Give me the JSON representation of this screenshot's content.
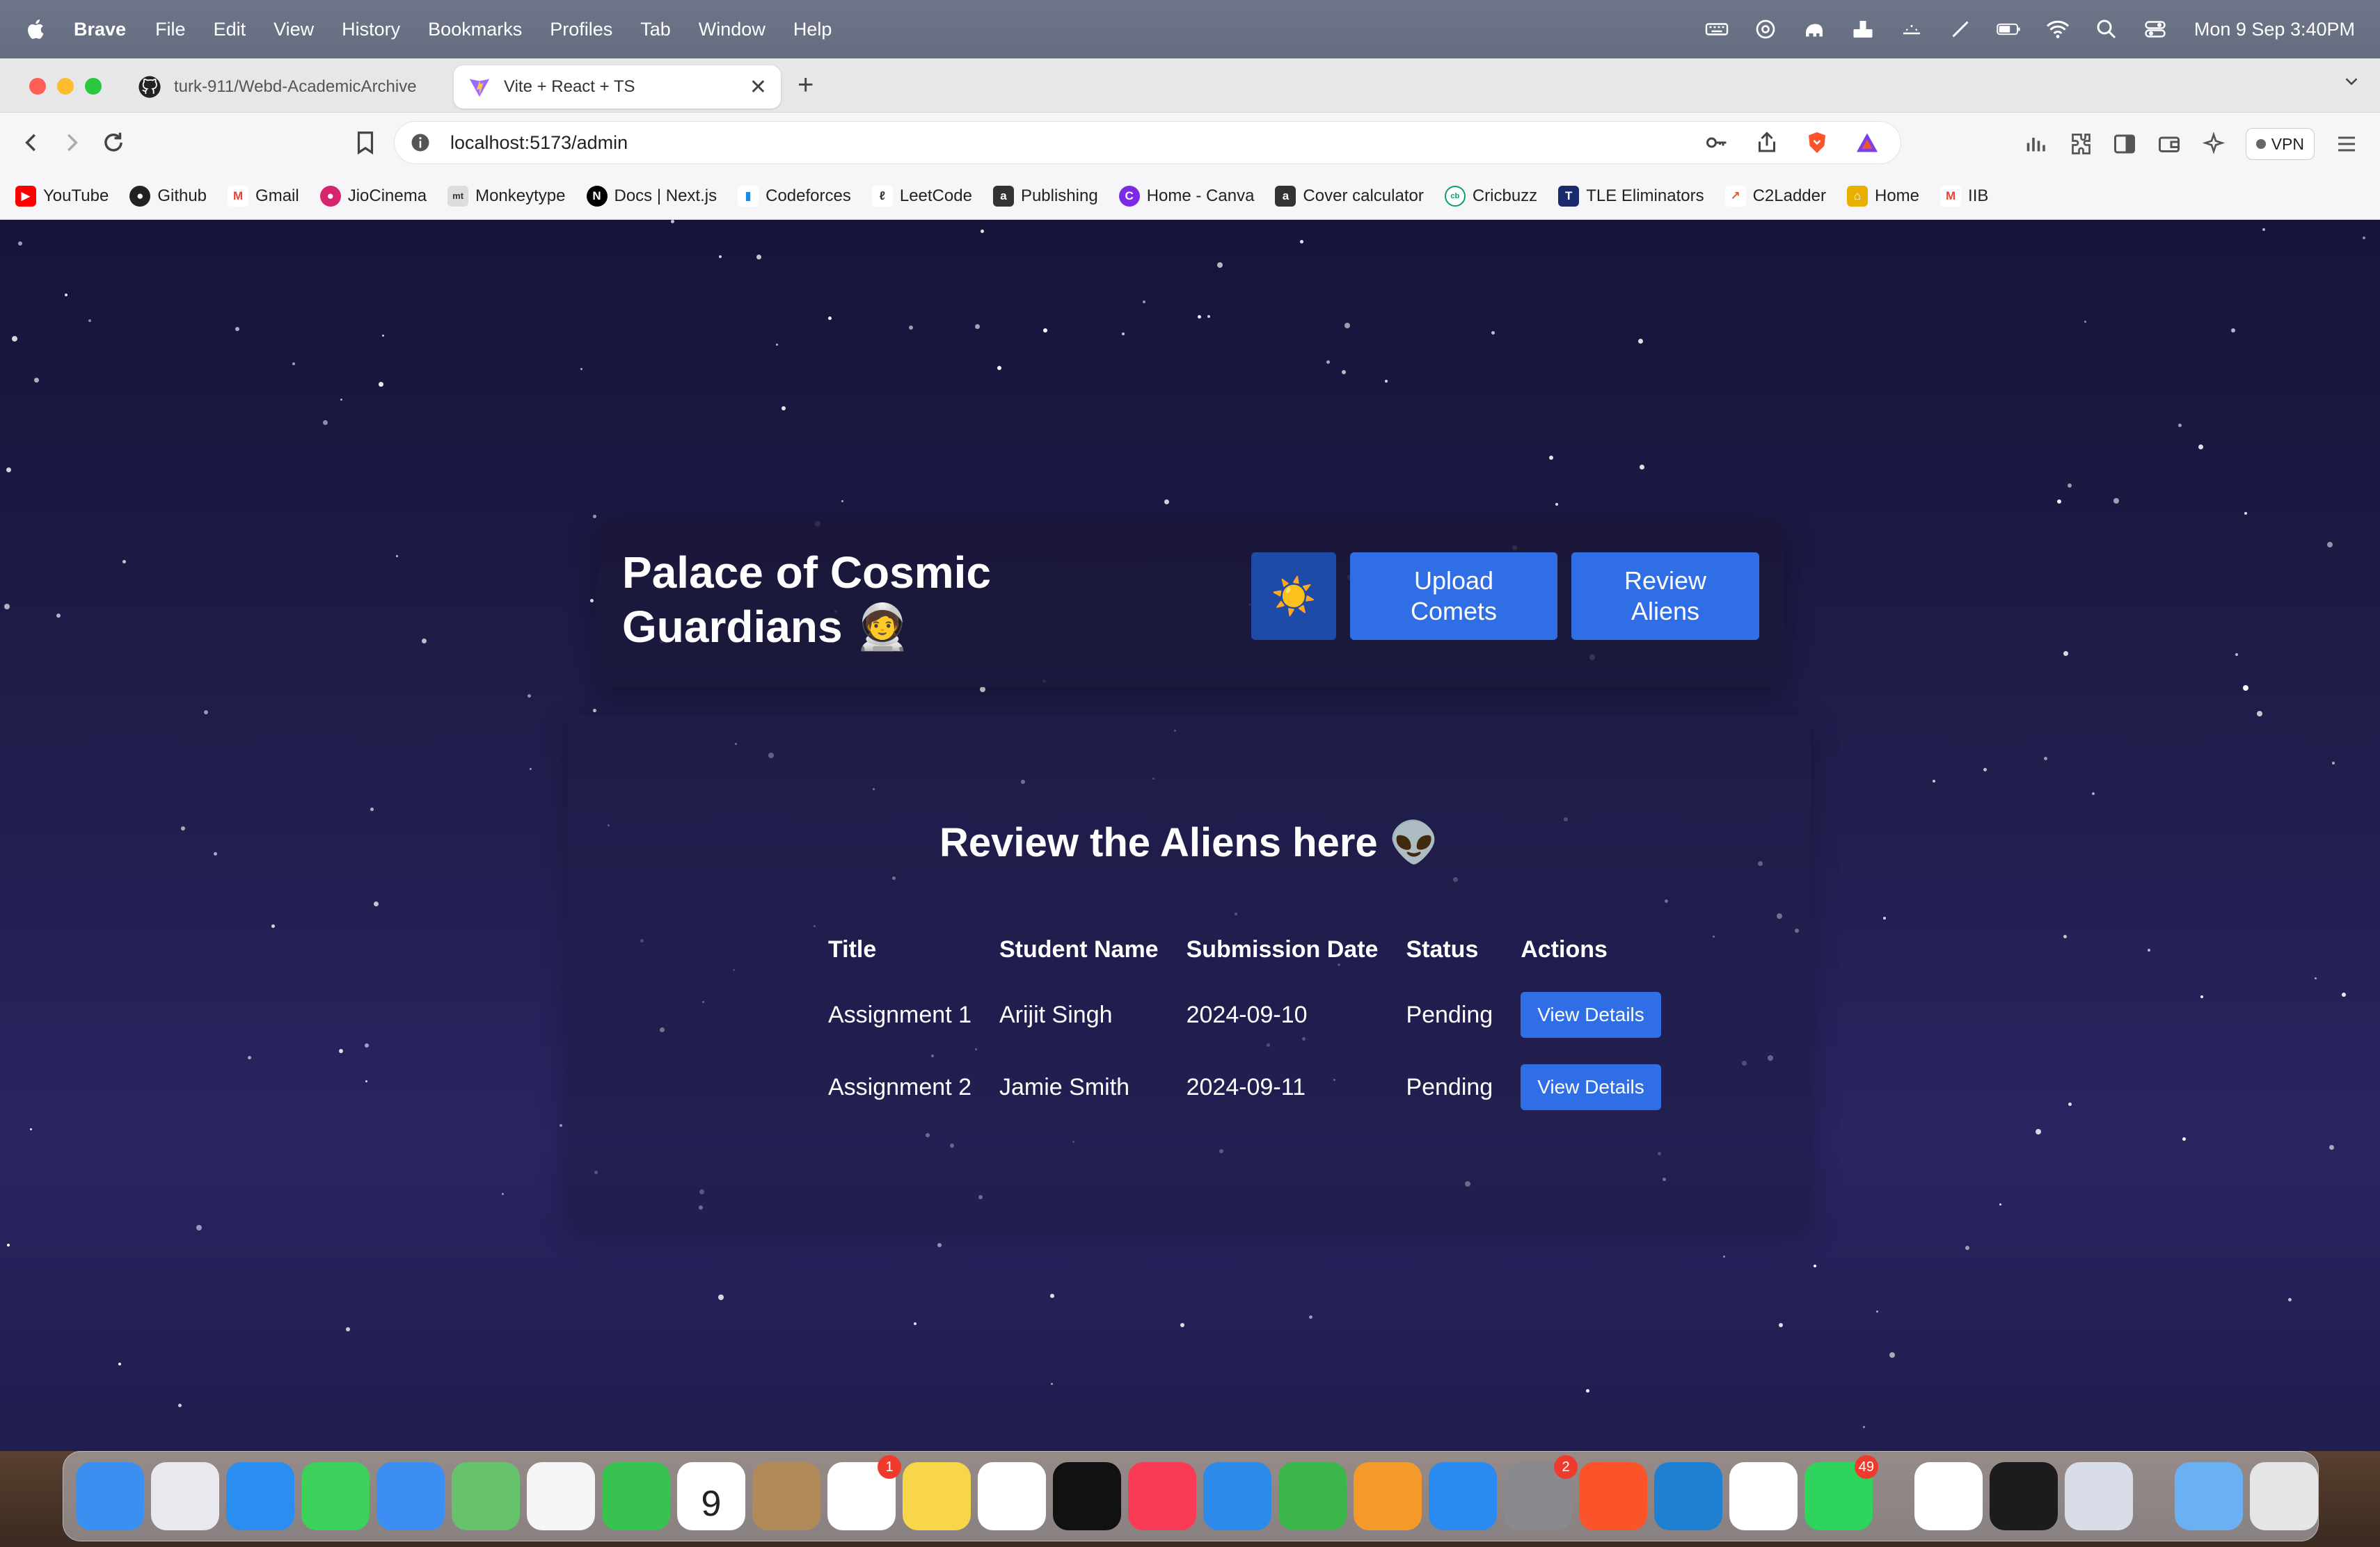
{
  "menubar": {
    "app_name": "Brave",
    "items": [
      "File",
      "Edit",
      "View",
      "History",
      "Bookmarks",
      "Profiles",
      "Tab",
      "Window",
      "Help"
    ],
    "clock": "Mon 9 Sep  3:40PM"
  },
  "browser": {
    "tabs": [
      {
        "title": "turk-911/Webd-AcademicArchive",
        "favicon": "github-icon"
      },
      {
        "title": "Vite + React + TS",
        "favicon": "vite-icon"
      }
    ],
    "url": "localhost:5173/admin",
    "vpn_label": "VPN",
    "bookmarks": [
      {
        "label": "YouTube",
        "color": "#ff0000"
      },
      {
        "label": "Github",
        "color": "#222222"
      },
      {
        "label": "Gmail",
        "color": "#ea4335"
      },
      {
        "label": "JioCinema",
        "color": "#d6246e"
      },
      {
        "label": "Monkeytype",
        "color": "#555555"
      },
      {
        "label": "Docs | Next.js",
        "color": "#000000"
      },
      {
        "label": "Codeforces",
        "color": "#1e88e5"
      },
      {
        "label": "LeetCode",
        "color": "#333333"
      },
      {
        "label": "Publishing",
        "color": "#333333"
      },
      {
        "label": "Home - Canva",
        "color": "#7d2ae8"
      },
      {
        "label": "Cover calculator",
        "color": "#333333"
      },
      {
        "label": "Cricbuzz",
        "color": "#0aa06e"
      },
      {
        "label": "TLE Eliminators",
        "color": "#1a2a6c"
      },
      {
        "label": "C2Ladder",
        "color": "#e05a2b"
      },
      {
        "label": "Home",
        "color": "#e8b100"
      },
      {
        "label": "IIB",
        "color": "#ea4335"
      }
    ]
  },
  "page": {
    "site_title": "Palace of Cosmic Guardians 🧑‍🚀",
    "theme_icon": "☀️",
    "upload_label": "Upload\nComets",
    "review_label": "Review\nAliens",
    "review_heading": "Review the Aliens here 👽",
    "table": {
      "headers": [
        "Title",
        "Student Name",
        "Submission Date",
        "Status",
        "Actions"
      ],
      "rows": [
        {
          "title": "Assignment 1",
          "student": "Arijit Singh",
          "date": "2024-09-10",
          "status": "Pending",
          "action": "View Details"
        },
        {
          "title": "Assignment 2",
          "student": "Jamie Smith",
          "date": "2024-09-11",
          "status": "Pending",
          "action": "View Details"
        }
      ]
    }
  },
  "dock": {
    "apps": [
      {
        "name": "finder",
        "color": "#3b8ff0"
      },
      {
        "name": "launchpad",
        "color": "#e8e8ee"
      },
      {
        "name": "safari",
        "color": "#2a8df0"
      },
      {
        "name": "messages",
        "color": "#3bd15a"
      },
      {
        "name": "mail",
        "color": "#3c8ef2"
      },
      {
        "name": "maps",
        "color": "#67c36b"
      },
      {
        "name": "photos",
        "color": "#f5f5f5"
      },
      {
        "name": "facetime",
        "color": "#38c24f"
      },
      {
        "name": "calendar",
        "color": "#ffffff",
        "text": "9"
      },
      {
        "name": "contacts",
        "color": "#b08a58"
      },
      {
        "name": "reminders",
        "color": "#ffffff",
        "badge": "1"
      },
      {
        "name": "notes",
        "color": "#f7d64a"
      },
      {
        "name": "freeform",
        "color": "#ffffff"
      },
      {
        "name": "apple-tv",
        "color": "#111111"
      },
      {
        "name": "music",
        "color": "#fa3b55"
      },
      {
        "name": "keynote",
        "color": "#2e8ae8"
      },
      {
        "name": "numbers",
        "color": "#3cb64a"
      },
      {
        "name": "pages",
        "color": "#f59a2a"
      },
      {
        "name": "app-store",
        "color": "#2a8af0"
      },
      {
        "name": "system-settings",
        "color": "#8a8a8e",
        "badge": "2"
      },
      {
        "name": "brave",
        "color": "#fb542b"
      },
      {
        "name": "vscode",
        "color": "#1f7fd0"
      },
      {
        "name": "chatgpt",
        "color": "#ffffff"
      },
      {
        "name": "whatsapp",
        "color": "#2fd45f",
        "badge": "49"
      },
      {
        "name": "chrome",
        "color": "#ffffff"
      },
      {
        "name": "clock",
        "color": "#1c1c1e"
      },
      {
        "name": "preview",
        "color": "#d8dde8"
      },
      {
        "name": "downloads-folder",
        "color": "#6ab0f2"
      },
      {
        "name": "trash",
        "color": "#e5e5e8"
      }
    ]
  }
}
